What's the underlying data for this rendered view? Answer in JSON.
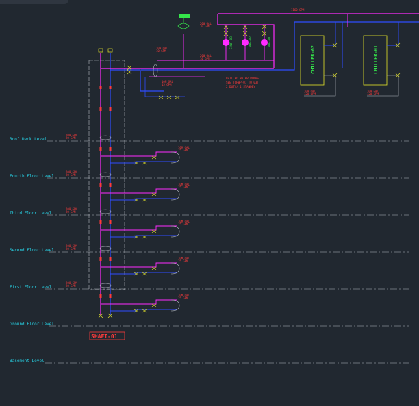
{
  "levels": [
    {
      "name": "Roof Deck Level"
    },
    {
      "name": "Fourth Floor Level"
    },
    {
      "name": "Third Floor Level"
    },
    {
      "name": "Second Floor Level"
    },
    {
      "name": "First Floor Level"
    },
    {
      "name": "Ground Floor Level"
    },
    {
      "name": "Basement Level"
    }
  ],
  "shaft": {
    "label": "SHAFT-01"
  },
  "chillers": [
    {
      "label": "CHILLER-02"
    },
    {
      "label": "CHILLER-01"
    }
  ],
  "pumps": [
    {
      "label": "CHWP-03"
    },
    {
      "label": "CHWP-02"
    },
    {
      "label": "CHWP-01"
    }
  ],
  "notes": {
    "pump_note_line1": "CHILLED WATER PUMPS",
    "pump_note_line2": "SEE (CHWP-01 TO 03)",
    "pump_note_line3": "2 DUTY/ 1 STANDBY",
    "header_flow": "1160 GPM",
    "shaft_flow_1": "200 GPM",
    "shaft_flow_2": "20 GPM"
  },
  "colors": {
    "background": "#212830",
    "supply": "#ff2bff",
    "return": "#2f4dff",
    "level_text": "#27d3e6",
    "annotation": "#ff3b3b",
    "equipment": "#e6e62a",
    "pump": "#35e64a",
    "outline": "#cfd3d8"
  }
}
